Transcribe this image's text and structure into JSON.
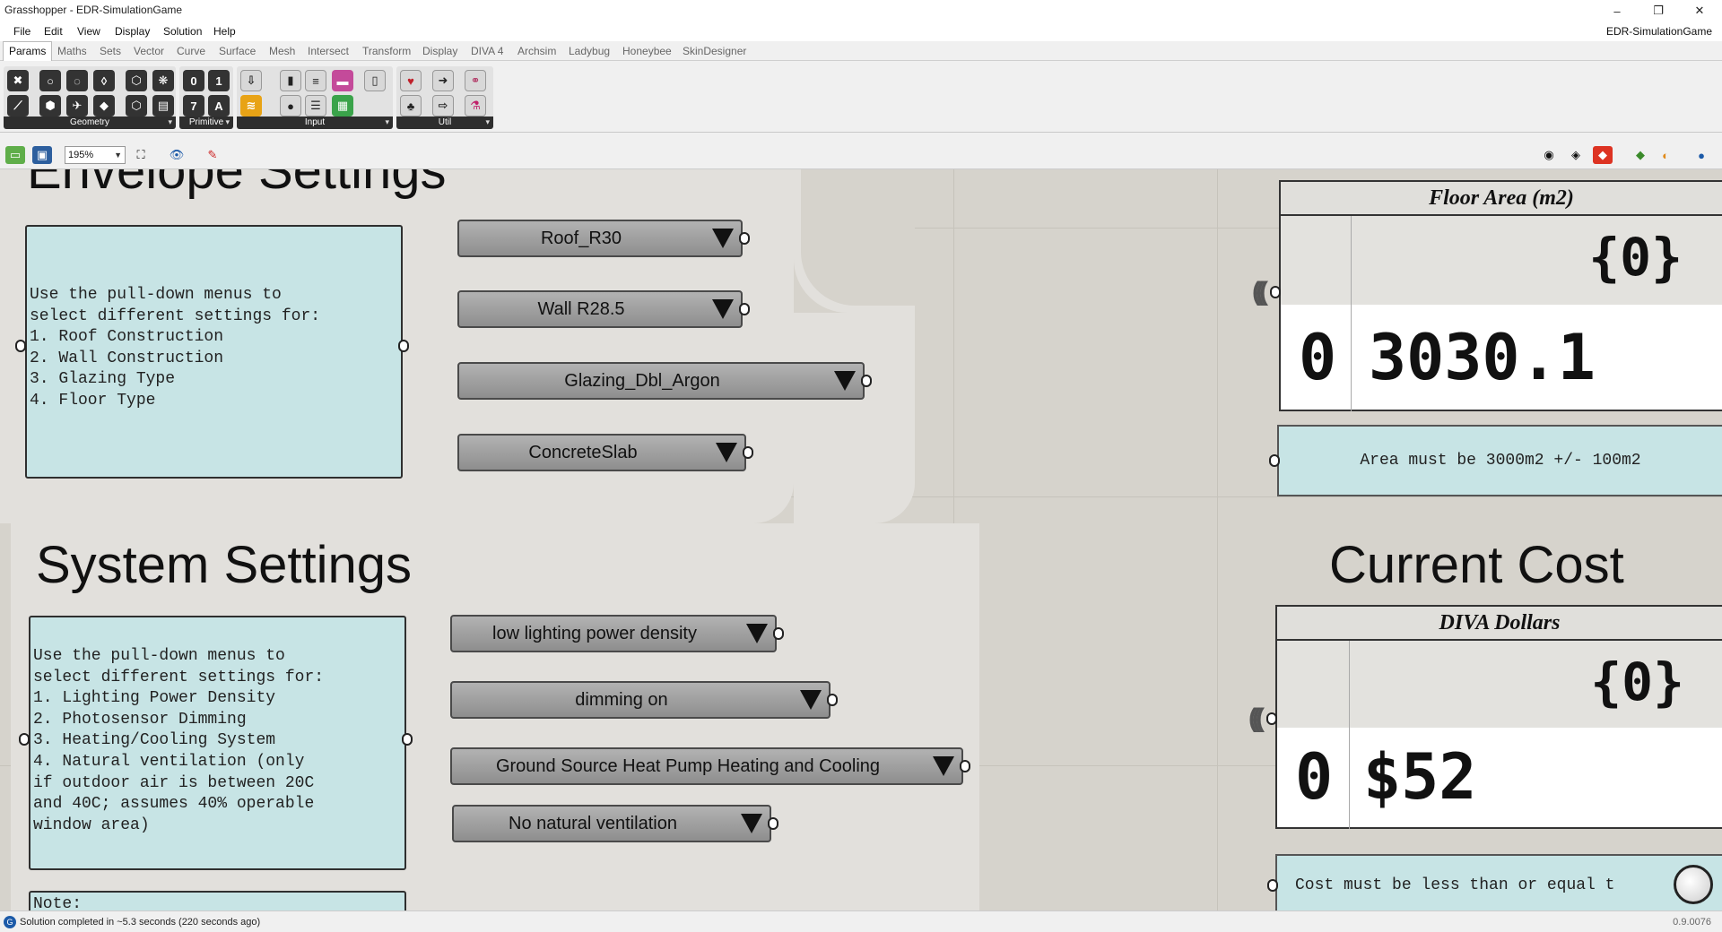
{
  "window": {
    "title": "Grasshopper - EDR-SimulationGame",
    "doc_name": "EDR-SimulationGame",
    "minimize": "–",
    "restore": "❐",
    "close": "✕"
  },
  "menu": [
    "File",
    "Edit",
    "View",
    "Display",
    "Solution",
    "Help"
  ],
  "tabs": [
    "Params",
    "Maths",
    "Sets",
    "Vector",
    "Curve",
    "Surface",
    "Mesh",
    "Intersect",
    "Transform",
    "Display",
    "DIVA 4",
    "Archsim",
    "Ladybug",
    "Honeybee",
    "SkinDesigner"
  ],
  "ribbon_groups": [
    "Geometry",
    "Primitive",
    "Input",
    "Util"
  ],
  "toolbar": {
    "zoom": "195%"
  },
  "envelope": {
    "heading": "Envelope Settings",
    "note": "Use the pull-down menus to\nselect different settings for:\n1. Roof Construction\n2. Wall Construction\n3. Glazing Type\n4. Floor Type",
    "dropdowns": [
      "Roof_R30",
      "Wall R28.5",
      "Glazing_Dbl_Argon",
      "ConcreteSlab"
    ]
  },
  "system": {
    "heading": "System Settings",
    "note": "Use the pull-down menus to\nselect different settings for:\n1. Lighting Power Density\n2. Photosensor Dimming\n3. Heating/Cooling System\n4. Natural ventilation (only\nif outdoor air is between 20C\nand 40C; assumes 40% operable\nwindow area)",
    "note2": "Note:",
    "dropdowns": [
      "low lighting power density",
      "dimming on",
      "Ground Source Heat Pump Heating and Cooling",
      "No natural ventilation"
    ]
  },
  "floor_area": {
    "title": "Floor Area (m2)",
    "path": "{0}",
    "index": "0",
    "value": "3030.1",
    "note": "Area must be 3000m2 +/- 100m2"
  },
  "cost": {
    "heading": "Current Cost",
    "title": "DIVA Dollars",
    "path": "{0}",
    "index": "0",
    "value": "$52",
    "note": "Cost must be less than or equal t"
  },
  "status": {
    "message": "Solution completed in ~5.3 seconds (220 seconds ago)",
    "version": "0.9.0076"
  }
}
